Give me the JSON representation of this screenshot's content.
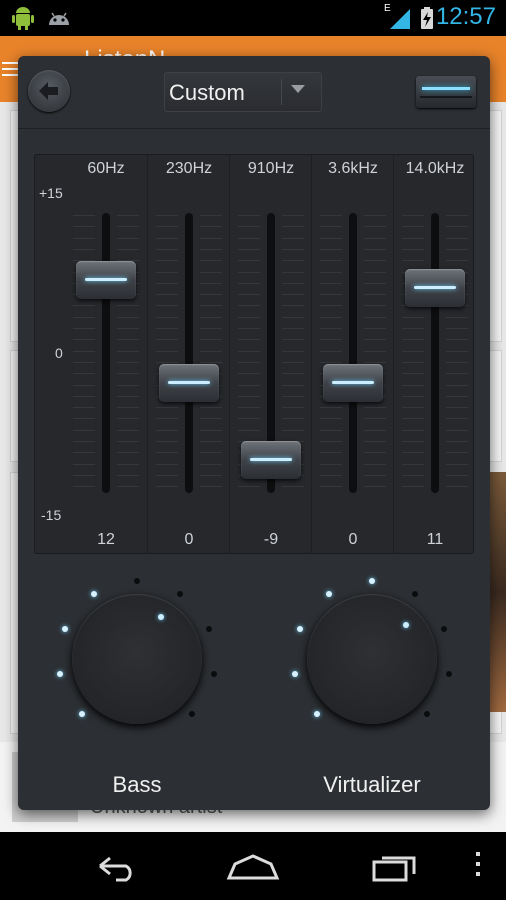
{
  "status_bar": {
    "time": "12:57",
    "network_label": "E",
    "icons": [
      "android-robot-icon",
      "android-head-icon",
      "signal-icon",
      "battery-charging-icon"
    ]
  },
  "background_app": {
    "title": "ListenN",
    "artist": "Unknown artist",
    "accent_color": "#e8832a"
  },
  "equalizer": {
    "preset": "Custom",
    "enabled": true,
    "scale": {
      "max": "+15",
      "mid": "0",
      "min": "-15"
    },
    "bands": [
      {
        "freq": "60Hz",
        "gain": "12",
        "value": 12
      },
      {
        "freq": "230Hz",
        "gain": "0",
        "value": 0
      },
      {
        "freq": "910Hz",
        "gain": "-9",
        "value": -9
      },
      {
        "freq": "3.6kHz",
        "gain": "0",
        "value": 0
      },
      {
        "freq": "14.0kHz",
        "gain": "11",
        "value": 11
      }
    ]
  },
  "effects": {
    "bass": {
      "label": "Bass",
      "level": 4,
      "steps": 9
    },
    "virtualizer": {
      "label": "Virtualizer",
      "level": 5,
      "steps": 9
    }
  },
  "colors": {
    "led": "#6fd0ff",
    "dialog_bg": "#2c2f33",
    "time": "#33b5e5"
  },
  "nav_bar": {
    "icons": [
      "back-icon",
      "home-icon",
      "recents-icon",
      "overflow-menu-icon"
    ]
  }
}
